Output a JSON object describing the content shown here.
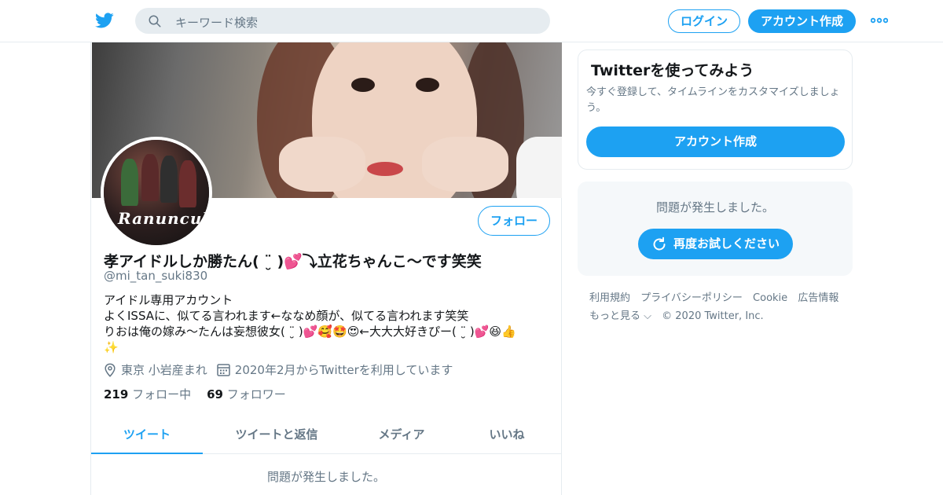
{
  "header": {
    "logo_icon": "twitter-bird-icon",
    "search_placeholder": "キーワード検索",
    "login_label": "ログイン",
    "signup_label": "アカウント作成",
    "more_icon": "more-dots-icon",
    "accent_color": "#1da1f2"
  },
  "profile": {
    "name": "孝アイドルしか勝たん( ¨̮ )💕⤵︎立花ちゃんこ〜です笑笑",
    "handle": "@mi_tan_suki830",
    "avatar_text": "Ranunculus",
    "follow_label": "フォロー",
    "bio_lines": [
      "アイドル専用アカウント",
      "よくISSAに、似てる言われます←ななめ顔が、似てる言われます笑笑",
      "りおは俺の嫁み〜たんは妄想彼女( ¨̮ )💕🥰🤩😍←大大大好きぴー( ¨̮ )💕😆👍",
      "✨"
    ],
    "location": "東京 小岩産まれ",
    "joined": "2020年2月からTwitterを利用しています",
    "following_count": "219",
    "following_label": "フォロー中",
    "followers_count": "69",
    "followers_label": "フォロワー"
  },
  "tabs": [
    {
      "label": "ツイート",
      "active": true
    },
    {
      "label": "ツイートと返信",
      "active": false
    },
    {
      "label": "メディア",
      "active": false
    },
    {
      "label": "いいね",
      "active": false
    }
  ],
  "timeline_error": "問題が発生しました。",
  "signup_card": {
    "title": "Twitterを使ってみよう",
    "description": "今すぐ登録して、タイムラインをカスタマイズしましょう。",
    "button_label": "アカウント作成"
  },
  "error_box": {
    "message": "問題が発生しました。",
    "retry_label": "再度お試しください",
    "retry_icon": "refresh-icon"
  },
  "footer": {
    "links": [
      "利用規約",
      "プライバシーポリシー",
      "Cookie",
      "広告情報",
      "もっと見る ⌵",
      "© 2020 Twitter, Inc."
    ]
  }
}
